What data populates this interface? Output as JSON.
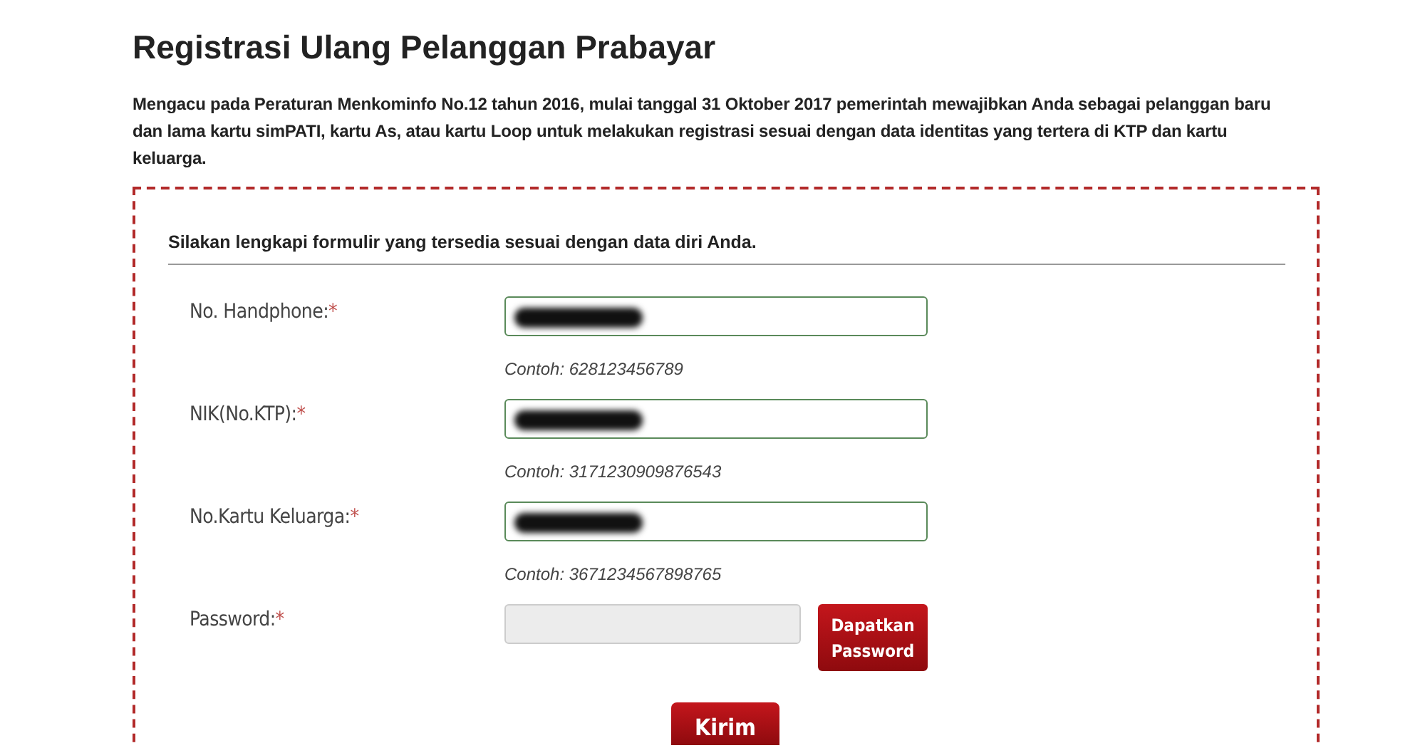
{
  "page": {
    "title": "Registrasi Ulang Pelanggan Prabayar",
    "intro": "Mengacu pada Peraturan Menkominfo No.12 tahun 2016, mulai tanggal 31 Oktober 2017 pemerintah mewajibkan Anda sebagai pelanggan baru dan lama kartu simPATI, kartu As, atau kartu Loop untuk melakukan registrasi sesuai dengan data identitas yang tertera di KTP dan kartu keluarga."
  },
  "form": {
    "heading": "Silakan lengkapi formulir yang tersedia sesuai dengan data diri Anda.",
    "fields": [
      {
        "label": "No. Handphone:",
        "required_mark": "*",
        "redacted": true,
        "disabled": false,
        "hint": "Contoh: 628123456789"
      },
      {
        "label": "NIK(No.KTP):",
        "required_mark": "*",
        "redacted": true,
        "disabled": false,
        "hint": "Contoh: 3171230909876543"
      },
      {
        "label": "No.Kartu Keluarga:",
        "required_mark": "*",
        "redacted": true,
        "disabled": false,
        "hint": "Contoh: 3671234567898765"
      },
      {
        "label": "Password:",
        "required_mark": "*",
        "redacted": false,
        "disabled": true,
        "button": "Dapatkan Password"
      }
    ],
    "submit": "Kirim"
  }
}
